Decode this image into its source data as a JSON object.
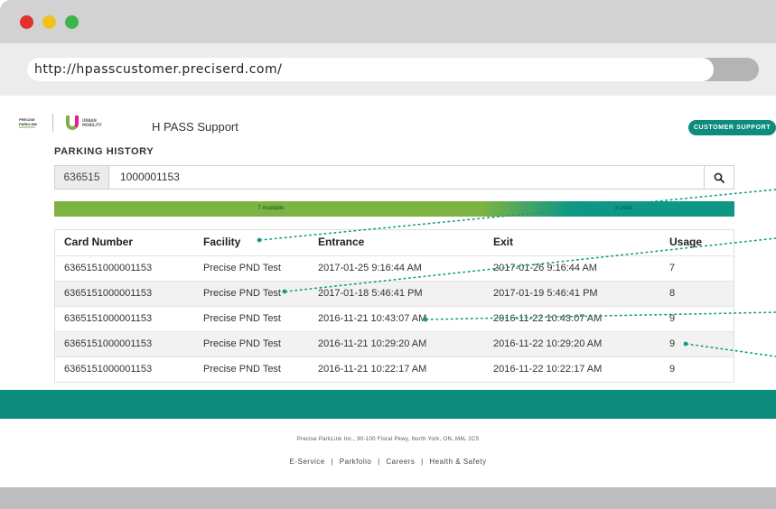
{
  "browser": {
    "url": "http://hpasscustomer.preciserd.com/"
  },
  "header": {
    "logo_pnd": "PRECISE PARKLINK",
    "logo_um": "URBAN MOBILITY",
    "title": "H PASS Support",
    "support_button": "CUSTOMER SUPPORT"
  },
  "section": {
    "title": "PARKING HISTORY"
  },
  "search": {
    "prefix": "636515",
    "value": "1000001153",
    "icon": "search-icon"
  },
  "usage": {
    "available_label": "7 Available",
    "used_label": "3 Used",
    "available_color": "#7cb342",
    "used_color": "#0e9785"
  },
  "table": {
    "columns": [
      "Card Number",
      "Facility",
      "Entrance",
      "Exit",
      "Usage"
    ],
    "rows": [
      [
        "6365151000001153",
        "Precise PND Test",
        "2017-01-25 9:16:44 AM",
        "2017-01-26 9:16:44 AM",
        "7"
      ],
      [
        "6365151000001153",
        "Precise PND Test",
        "2017-01-18 5:46:41 PM",
        "2017-01-19 5:46:41 PM",
        "8"
      ],
      [
        "6365151000001153",
        "Precise PND Test",
        "2016-11-21 10:43:07 AM",
        "2016-11-22 10:43:07 AM",
        "9"
      ],
      [
        "6365151000001153",
        "Precise PND Test",
        "2016-11-21 10:29:20 AM",
        "2016-11-22 10:29:20 AM",
        "9"
      ],
      [
        "6365151000001153",
        "Precise PND Test",
        "2016-11-21 10:22:17 AM",
        "2016-11-22 10:22:17 AM",
        "9"
      ]
    ]
  },
  "footer": {
    "address": "Precise ParkLink Inc., 90-100 Floral Pkwy, North York, ON, M6L 2C5",
    "links": [
      "E-Service",
      "Parkfolio",
      "Careers",
      "Health & Safety"
    ],
    "separator": "|"
  },
  "colors": {
    "teal": "#0d8b7c",
    "green": "#7cb342",
    "annotation": "#139b8c"
  }
}
